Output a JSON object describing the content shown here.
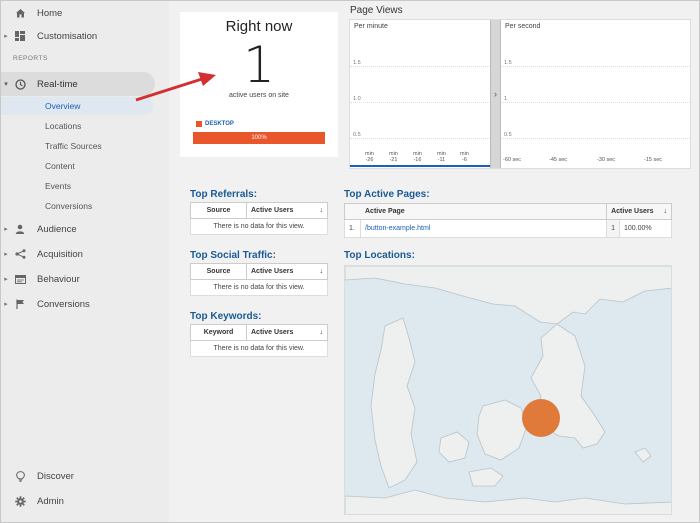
{
  "sidebar": {
    "home": "Home",
    "customisation": "Customisation",
    "reports_label": "REPORTS",
    "realtime": "Real-time",
    "realtime_items": [
      "Overview",
      "Locations",
      "Traffic Sources",
      "Content",
      "Events",
      "Conversions"
    ],
    "audience": "Audience",
    "acquisition": "Acquisition",
    "behaviour": "Behaviour",
    "conversions": "Conversions",
    "discover": "Discover",
    "admin": "Admin"
  },
  "right_now": {
    "title": "Right now",
    "count": "1",
    "subtitle": "active users on site",
    "legend": "DESKTOP",
    "bar_label": "100%",
    "bar_fraction": 1.0
  },
  "page_views": {
    "title": "Page Views",
    "per_minute": {
      "label": "Per minute",
      "y_ticks": [
        "1.5",
        "1.0",
        "0.5"
      ],
      "x_ticks": [
        {
          "top": "min",
          "bottom": "-26"
        },
        {
          "top": "min",
          "bottom": "-21"
        },
        {
          "top": "min",
          "bottom": "-16"
        },
        {
          "top": "min",
          "bottom": "-11"
        },
        {
          "top": "min",
          "bottom": "-6"
        }
      ]
    },
    "per_second": {
      "label": "Per second",
      "y_ticks": [
        "1.5",
        "1",
        "0.5"
      ],
      "x_ticks": [
        "-60 sec",
        "-45 sec",
        "-30 sec",
        "-15 sec"
      ]
    },
    "toggle": "›"
  },
  "top_referrals": {
    "title": "Top Referrals:",
    "col1": "Source",
    "col2": "Active Users",
    "empty": "There is no data for this view."
  },
  "top_social": {
    "title": "Top Social Traffic:",
    "col1": "Source",
    "col2": "Active Users",
    "empty": "There is no data for this view."
  },
  "top_keywords": {
    "title": "Top Keywords:",
    "col1": "Keyword",
    "col2": "Active Users",
    "empty": "There is no data for this view."
  },
  "top_pages": {
    "title": "Top Active Pages:",
    "col1": "Active Page",
    "col2": "Active Users",
    "rows": [
      {
        "index": "1.",
        "page": "/button-example.html",
        "users": "1",
        "pct": "100.00%"
      }
    ]
  },
  "top_locations": {
    "title": "Top Locations:"
  },
  "sort_icon": "↓",
  "colors": {
    "accent_orange": "#e8562a",
    "link_blue": "#1a62b5",
    "arrow_red": "#d32f2f",
    "map_marker": "#e07a3a"
  }
}
